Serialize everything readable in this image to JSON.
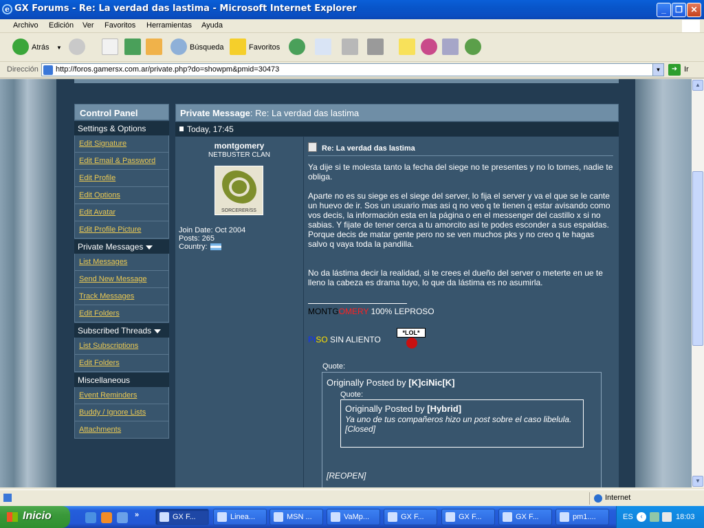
{
  "window": {
    "title": "GX Forums - Re: La verdad das lastima - Microsoft Internet Explorer"
  },
  "menu": [
    "Archivo",
    "Edición",
    "Ver",
    "Favoritos",
    "Herramientas",
    "Ayuda"
  ],
  "toolbar": {
    "back": "Atrás",
    "search": "Búsqueda",
    "favorites": "Favoritos"
  },
  "address": {
    "label": "Dirección",
    "url": "http://foros.gamersx.com.ar/private.php?do=showpm&pmid=30473",
    "go": "Ir"
  },
  "control_panel": {
    "title": "Control Panel",
    "settings_header": "Settings & Options",
    "settings_items": [
      "Edit Signature",
      "Edit Email & Password",
      "Edit Profile",
      "Edit Options",
      "Edit Avatar",
      "Edit Profile Picture"
    ],
    "pm_header": "Private Messages",
    "pm_items": [
      "List Messages",
      "Send New Message",
      "Track Messages",
      "Edit Folders"
    ],
    "subs_header": "Subscribed Threads",
    "subs_items": [
      "List Subscriptions",
      "Edit Folders"
    ],
    "misc_header": "Miscellaneous",
    "misc_items": [
      "Event Reminders",
      "Buddy / Ignore Lists",
      "Attachments"
    ]
  },
  "pm": {
    "header_label": "Private Message",
    "header_title": ": Re: La verdad das lastima",
    "date": "Today, 17:45",
    "title": "Re: La verdad das lastima",
    "paragraphs": [
      "Ya dije si te molesta tanto la fecha del siege no te presentes y no lo tomes, nadie te obliga.",
      "Aparte no es su siege es el siege del server, lo fija el server y va el que se le cante un huevo de ir. Sos un usuario mas asi q no veo q te tienen q estar avisando como vos decis, la información esta en la página o en el messenger del castillo x si no sabias. Y fijate de tener cerca a tu amorcito asi te podes esconder a sus espaldas. Porque decis de matar gente pero no se ven muchos pks y no creo q te hagas salvo q vaya toda la pandilla.",
      "No da lástima decir la realidad, si te crees el dueño del server o meterte en ue te lleno la cabeza es drama tuyo, lo que da lástima es no asumirla."
    ],
    "sig1": {
      "part1": "MONTG",
      "part2": "OMERY",
      "part3": " 100% LEPROSO"
    },
    "sig2": {
      "part1": "PI",
      "part2": "SO",
      "part3": " SIN ALIENTO"
    },
    "lol_sign": "*LOL*",
    "quote_label": "Quote:",
    "quote1": {
      "prefix": "Originally Posted by ",
      "author": "[K]ciNic[K]",
      "reopen": "[REOPEN]"
    },
    "quote2": {
      "label": "Quote:",
      "prefix": "Originally Posted by ",
      "author": "[Hybrid]",
      "text": "Ya uno de tus compañeros hizo un post sobre el caso libelula.",
      "closed": "[Closed]"
    }
  },
  "user": {
    "name": "montgomery",
    "title": "NETBUSTER CLAN",
    "avatar_caption": "SORCERER/SS",
    "join_date": "Join Date: Oct 2004",
    "posts": "Posts: 265",
    "country": "Country:"
  },
  "status": {
    "zone": "Internet"
  },
  "taskbar": {
    "start": "Inicio",
    "tasks": [
      "GX F...",
      "Linea...",
      "MSN ...",
      "VaMp...",
      "GX F...",
      "GX F...",
      "GX F...",
      "pm1...."
    ],
    "lang": "ES",
    "clock": "18:03"
  }
}
